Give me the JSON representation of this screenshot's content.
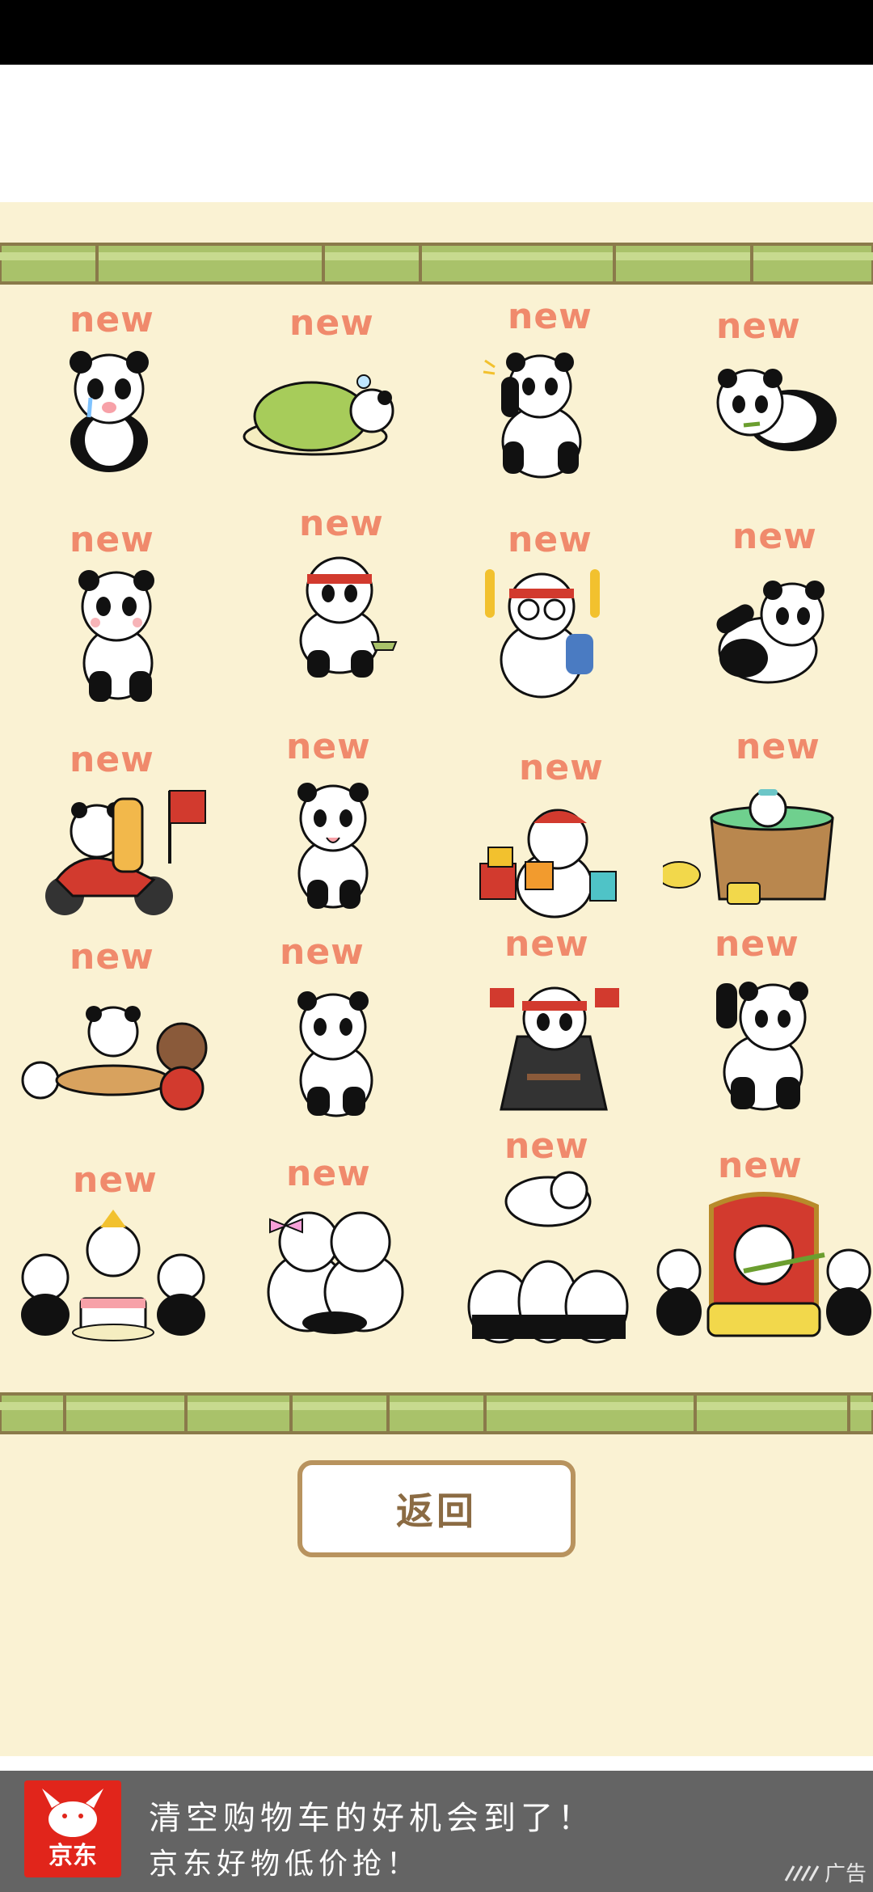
{
  "grid": {
    "rows": [
      [
        "new",
        "new",
        "new",
        "new"
      ],
      [
        "new",
        "new",
        "new",
        "new"
      ],
      [
        "new",
        "new",
        "new",
        "new"
      ],
      [
        "new",
        "new",
        "new",
        "new"
      ],
      [
        "new",
        "new",
        "new",
        "new"
      ]
    ]
  },
  "back_button": {
    "label": "返回"
  },
  "ad": {
    "logo_text": "京东",
    "line1": "清空购物车的好机会到了！",
    "line2": "京东好物低价抢！",
    "tag": "广告"
  },
  "colors": {
    "background": "#faf2d3",
    "new_label": "#f08a6c",
    "bamboo": "#a9c26a",
    "button_border": "#b8935e",
    "ad_bg": "#646464",
    "jd_red": "#e1251b"
  },
  "icons": [
    "panda-sticker",
    "jd-dog-icon",
    "ad-brand-icon"
  ]
}
